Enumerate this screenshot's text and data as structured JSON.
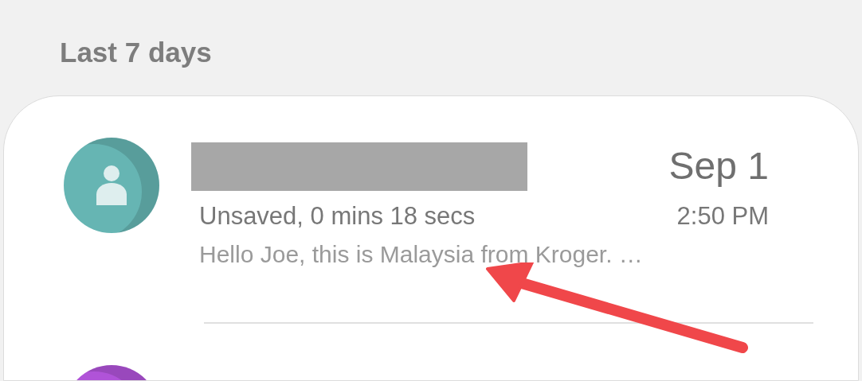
{
  "section_header": "Last 7 days",
  "calls": [
    {
      "color": "#66b5b3",
      "redacted_name": true,
      "date": "Sep 1",
      "detail": "Unsaved, 0 mins 18 secs",
      "time": "2:50 PM",
      "preview": "Hello Joe, this is Malaysia from Kroger. …"
    },
    {
      "color": "#b053d8"
    }
  ]
}
